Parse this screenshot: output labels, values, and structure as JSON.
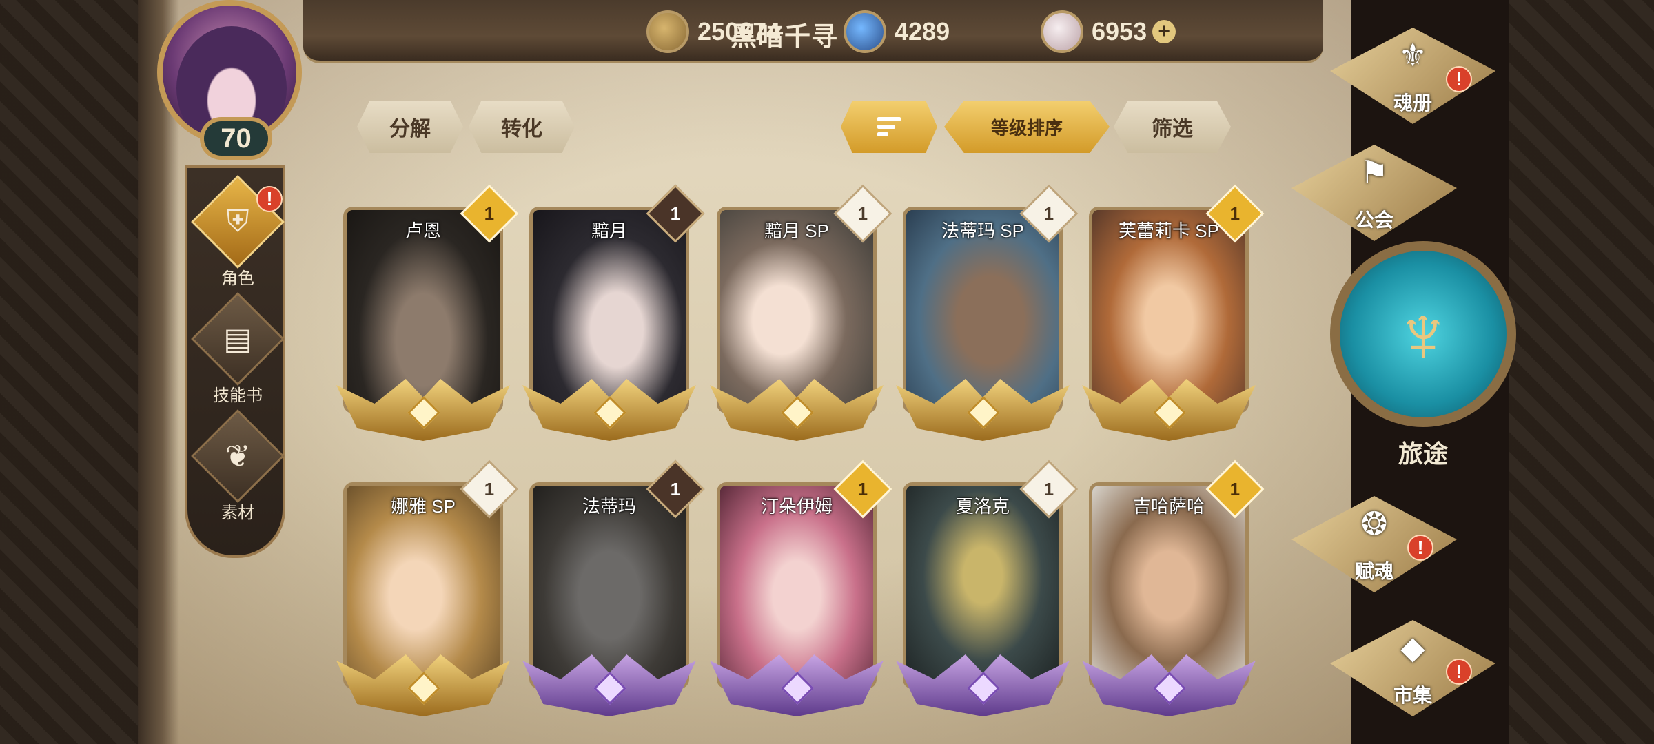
{
  "player": {
    "name": "黑暗千寻",
    "level": "70"
  },
  "resources": [
    {
      "name": "gold",
      "value": "250674",
      "icon": "coin-icon"
    },
    {
      "name": "crystal",
      "value": "4289",
      "icon": "crystal-icon"
    },
    {
      "name": "gem",
      "value": "6953",
      "icon": "gem-icon",
      "plus": "+"
    }
  ],
  "left_nav": [
    {
      "label": "角色",
      "icon": "helmet-icon",
      "active": true,
      "alert": "!"
    },
    {
      "label": "技能书",
      "icon": "book-icon",
      "active": false
    },
    {
      "label": "素材",
      "icon": "material-icon",
      "active": false
    }
  ],
  "toolbar": {
    "decompose": "分解",
    "convert": "转化",
    "sort_level": "等级排序",
    "filter": "筛选"
  },
  "cards": [
    {
      "name": "卢恩",
      "rank": "1",
      "rank_style": "gold",
      "base": "gold"
    },
    {
      "name": "黯月",
      "rank": "1",
      "rank_style": "dark",
      "base": "gold"
    },
    {
      "name": "黯月 SP",
      "rank": "1",
      "rank_style": "white",
      "base": "gold"
    },
    {
      "name": "法蒂玛 SP",
      "rank": "1",
      "rank_style": "white",
      "base": "gold"
    },
    {
      "name": "芙蕾莉卡 SP",
      "rank": "1",
      "rank_style": "gold",
      "base": "gold"
    },
    {
      "name": "娜雅 SP",
      "rank": "1",
      "rank_style": "white",
      "base": "gold"
    },
    {
      "name": "法蒂玛",
      "rank": "1",
      "rank_style": "dark",
      "base": "purple"
    },
    {
      "name": "汀朵伊姆",
      "rank": "1",
      "rank_style": "gold",
      "base": "purple"
    },
    {
      "name": "夏洛克",
      "rank": "1",
      "rank_style": "white",
      "base": "purple"
    },
    {
      "name": "吉哈萨哈",
      "rank": "1",
      "rank_style": "gold",
      "base": "purple"
    }
  ],
  "right_nav": [
    {
      "label": "魂册",
      "icon": "soul-book-icon",
      "alert": "!"
    },
    {
      "label": "公会",
      "icon": "guild-icon"
    },
    {
      "label": "赋魂",
      "icon": "ensoul-icon",
      "alert": "!"
    },
    {
      "label": "市集",
      "icon": "market-icon",
      "alert": "!"
    }
  ],
  "journey": {
    "label": "旅途",
    "icon": "journey-icon"
  },
  "colors": {
    "gold": "#e9b42e",
    "alert": "#d9412a",
    "teal": "#1a8fa3"
  }
}
